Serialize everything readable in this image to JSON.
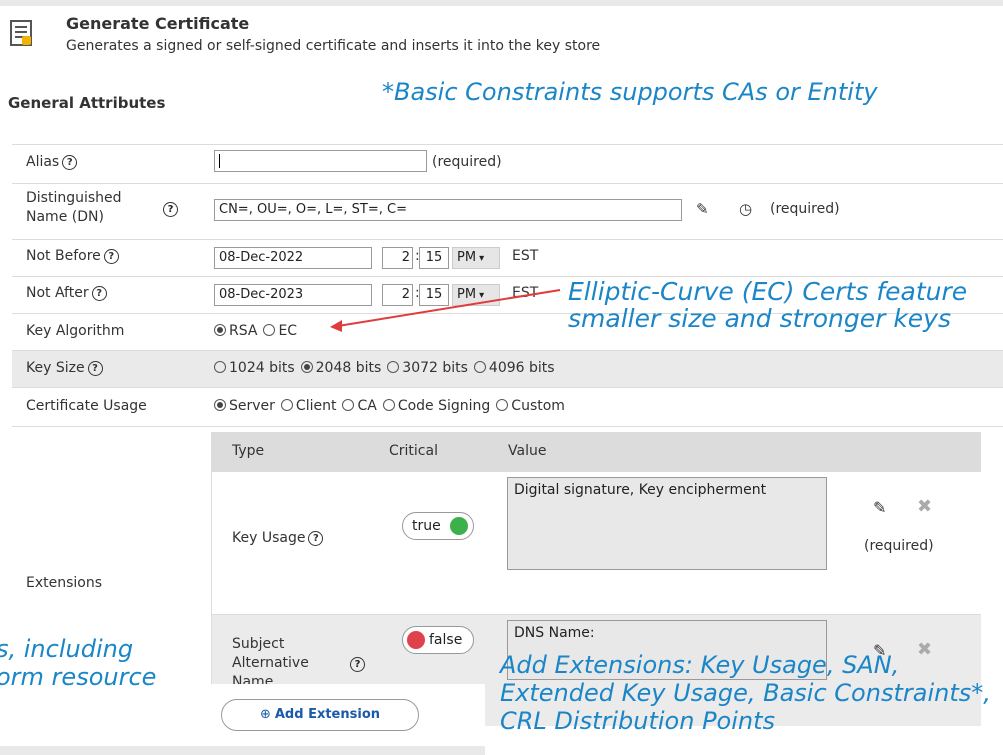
{
  "header": {
    "icon": "certificate-document-icon",
    "title": "Generate Certificate",
    "subtitle": "Generates a signed or self-signed certificate and inserts it into the key store"
  },
  "section_title": "General Attributes",
  "form": {
    "alias": {
      "label": "Alias",
      "value": "",
      "note": "(required)"
    },
    "dn": {
      "label_line1": "Distinguished",
      "label_line2": "Name (DN)",
      "value": "CN=, OU=, O=, L=, ST=, C=",
      "note": "(required)"
    },
    "not_before": {
      "label": "Not Before",
      "date": "08-Dec-2022",
      "hour": "2",
      "minute": "15",
      "ampm": "PM",
      "tz": "EST"
    },
    "not_after": {
      "label": "Not After",
      "date": "08-Dec-2023",
      "hour": "2",
      "minute": "15",
      "ampm": "PM",
      "tz": "EST"
    },
    "key_algorithm": {
      "label": "Key Algorithm",
      "options": [
        "RSA",
        "EC"
      ],
      "selected": "RSA"
    },
    "key_size": {
      "label": "Key Size",
      "options": [
        "1024 bits",
        "2048 bits",
        "3072 bits",
        "4096 bits"
      ],
      "selected": "2048 bits"
    },
    "cert_usage": {
      "label": "Certificate Usage",
      "options": [
        "Server",
        "Client",
        "CA",
        "Code Signing",
        "Custom"
      ],
      "selected": "Server"
    }
  },
  "extensions": {
    "label": "Extensions",
    "columns": [
      "Type",
      "Critical",
      "Value"
    ],
    "rows": [
      {
        "type": "Key Usage",
        "critical": "true",
        "value": "Digital signature, Key encipherment",
        "note": "(required)"
      },
      {
        "type_line1": "Subject",
        "type_line2": "Alternative",
        "type_line3": "Name",
        "critical": "false",
        "value": "DNS Name:"
      }
    ],
    "add_button": "Add Extension"
  },
  "annotations": {
    "basic_constraints": "*Basic Constraints supports CAs or Entity",
    "ec_line1": "Elliptic-Curve (EC) Certs feature",
    "ec_line2": "smaller size and stronger keys",
    "left_line1": "s, including",
    "left_line2": "orm resource",
    "ext_line1": "Add Extensions: Key Usage, SAN,",
    "ext_line2": "Extended Key Usage, Basic Constraints*,",
    "ext_line3": "CRL Distribution Points"
  },
  "colors": {
    "annotation": "#1a86c8",
    "toggle_true": "#3cb04a",
    "toggle_false": "#e0414a",
    "arrow": "#e03c3c"
  }
}
